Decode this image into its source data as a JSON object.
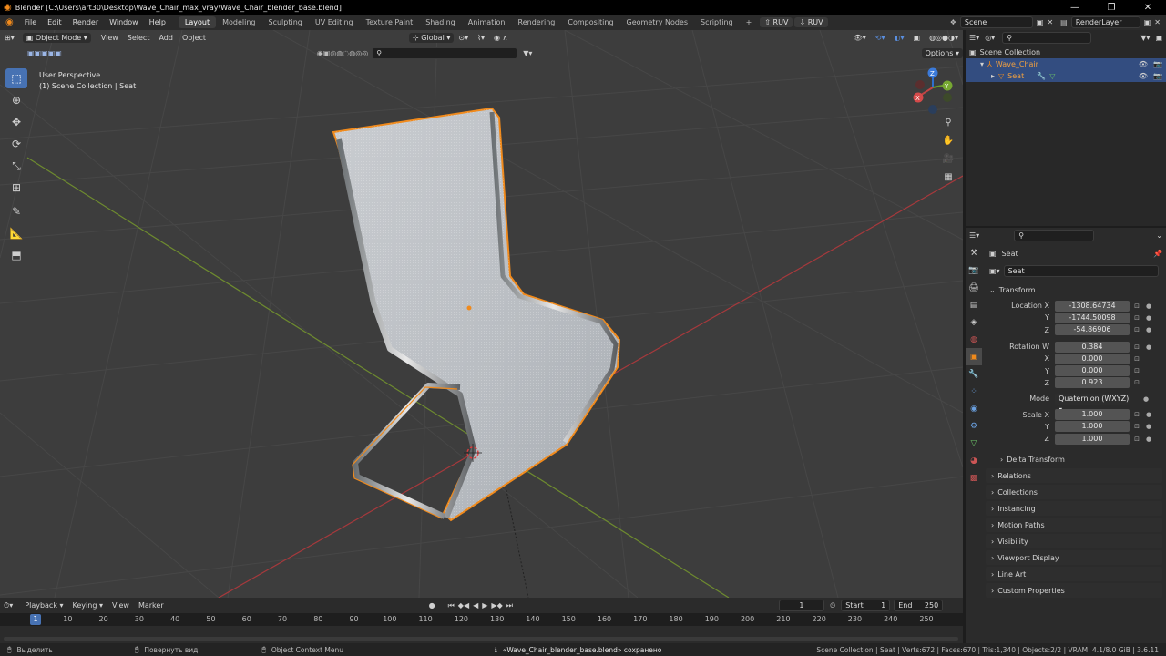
{
  "title_bar": {
    "title": "Blender [C:\\Users\\art30\\Desktop\\Wave_Chair_max_vray\\Wave_Chair_blender_base.blend]",
    "minimize": "—",
    "maximize": "❐",
    "close": "✕"
  },
  "menu": {
    "items": [
      "File",
      "Edit",
      "Render",
      "Window",
      "Help"
    ],
    "workspaces": [
      "Layout",
      "Modeling",
      "Sculpting",
      "UV Editing",
      "Texture Paint",
      "Shading",
      "Animation",
      "Rendering",
      "Compositing",
      "Geometry Nodes",
      "Scripting"
    ],
    "active_workspace": "Layout",
    "add_tab": "+",
    "ruv1": "RUV",
    "ruv2": "RUV",
    "scene": "Scene",
    "view_layer": "RenderLayer"
  },
  "viewport": {
    "mode": "Object Mode",
    "menus": [
      "View",
      "Select",
      "Add",
      "Object"
    ],
    "orientation": "Global",
    "options": "Options",
    "info_line1": "User Perspective",
    "info_line2": "(1) Scene Collection | Seat",
    "gizmo": {
      "x": "X",
      "y": "Y",
      "z": "Z"
    },
    "colors": {
      "selection_outline": "#f08a1c",
      "grid_bg": "#3d3d3d",
      "x_axis": "#a6393c",
      "y_axis": "#6e8b2f"
    }
  },
  "outliner": {
    "root": "Scene Collection",
    "items": [
      {
        "label": "Wave_Chair",
        "selected": true
      },
      {
        "label": "Seat",
        "selected": true
      }
    ]
  },
  "properties": {
    "object_name": "Seat",
    "data_name": "Seat",
    "transform_header": "Transform",
    "location": {
      "label": "Location X",
      "x": "-1308.64734",
      "y_label": "Y",
      "y": "-1744.50098",
      "z_label": "Z",
      "z": "-54.86906"
    },
    "rotation": {
      "label": "Rotation W",
      "w": "0.384",
      "x_label": "X",
      "x": "0.000",
      "y_label": "Y",
      "y": "0.000",
      "z_label": "Z",
      "z": "0.923"
    },
    "mode_label": "Mode",
    "mode_value": "Quaternion (WXYZ)",
    "scale": {
      "label": "Scale X",
      "x": "1.000",
      "y_label": "Y",
      "y": "1.000",
      "z_label": "Z",
      "z": "1.000"
    },
    "delta_transform": "Delta Transform",
    "panels": [
      "Relations",
      "Collections",
      "Instancing",
      "Motion Paths",
      "Visibility",
      "Viewport Display",
      "Line Art",
      "Custom Properties"
    ]
  },
  "timeline": {
    "menus": [
      "Playback",
      "Keying",
      "View",
      "Marker"
    ],
    "current_frame": "1",
    "start_label": "Start",
    "start": "1",
    "end_label": "End",
    "end": "250",
    "ruler": [
      "1",
      "10",
      "20",
      "30",
      "40",
      "50",
      "60",
      "70",
      "80",
      "90",
      "100",
      "110",
      "120",
      "130",
      "140",
      "150",
      "160",
      "170",
      "180",
      "190",
      "200",
      "210",
      "220",
      "230",
      "240",
      "250"
    ]
  },
  "status_bar": {
    "select": "Выделить",
    "rotate": "Повернуть вид",
    "context": "Object Context Menu",
    "message": "«Wave_Chair_blender_base.blend» сохранено",
    "stats": "Scene Collection | Seat | Verts:672 | Faces:670 | Tris:1,340 | Objects:2/2 | VRAM: 4.1/8.0 GiB | 3.6.11"
  }
}
